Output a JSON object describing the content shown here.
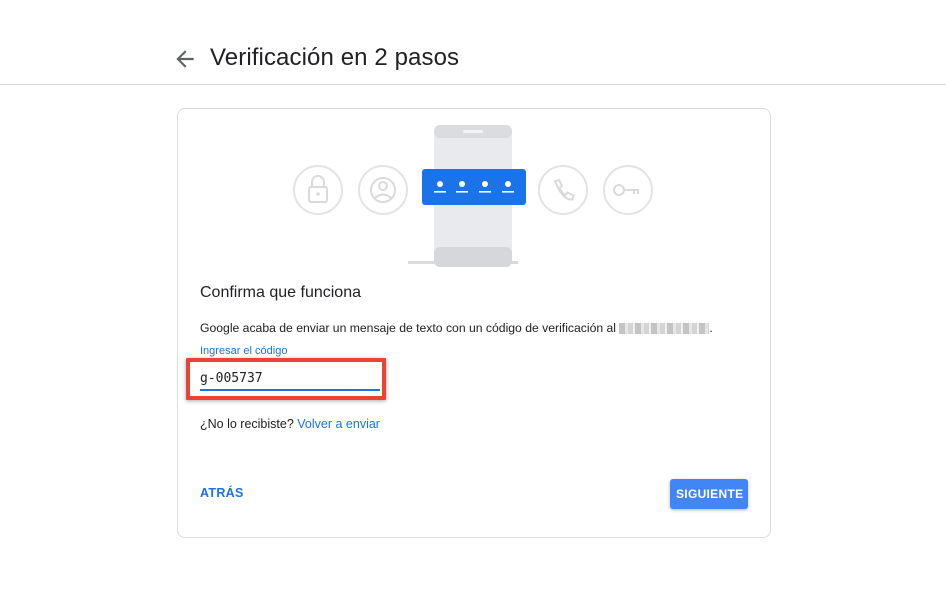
{
  "header": {
    "title": "Verificación en 2 pasos",
    "back_icon": "arrow-left-icon"
  },
  "card": {
    "illustration": {
      "icons": [
        "lock-icon",
        "person-icon",
        "phone-sms-code-icon",
        "phone-call-icon",
        "key-icon"
      ],
      "accent": "#1a73e8"
    },
    "heading": "Confirma que funciona",
    "description": "Google acaba de enviar un mensaje de texto con un código de verificación al",
    "description_end": ".",
    "code_field": {
      "label": "Ingresar el código",
      "value": "g-005737"
    },
    "resend": {
      "prompt": "¿No lo recibiste?",
      "link": "Volver a enviar"
    },
    "buttons": {
      "back": "ATRÁS",
      "next": "SIGUIENTE"
    }
  },
  "colors": {
    "primary": "#1a73e8",
    "button_blue": "#4285f4",
    "highlight": "#ea4335"
  }
}
